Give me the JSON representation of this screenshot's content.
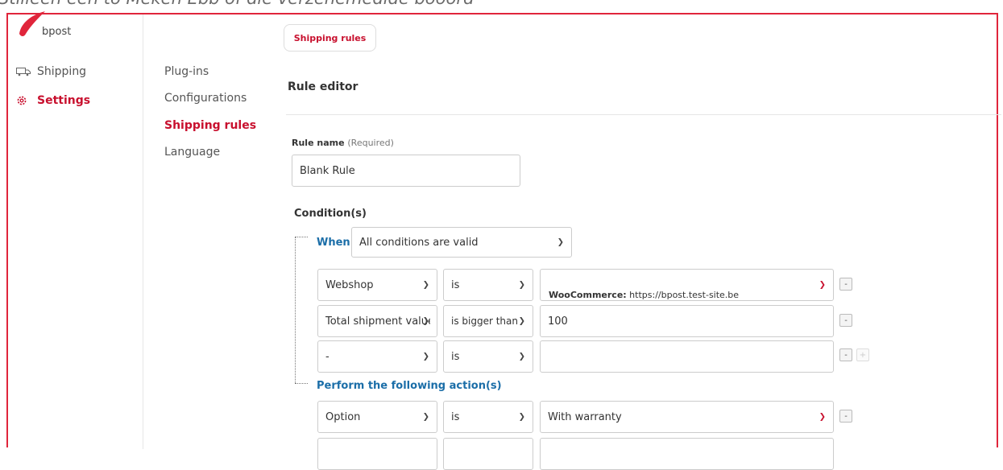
{
  "caption": "Stilleen een to Meken Ebb of die verzenemedide booord",
  "brand": {
    "name": "bpost",
    "accent": "#c8102e",
    "link": "#1b6ea8"
  },
  "sidebar": {
    "items": [
      {
        "label": "Shipping",
        "icon": "truck-icon"
      },
      {
        "label": "Settings",
        "icon": "gear-icon"
      }
    ]
  },
  "subnav": {
    "items": [
      "Plug-ins",
      "Configurations",
      "Shipping rules",
      "Language"
    ]
  },
  "tab": {
    "label": "Shipping rules"
  },
  "editor": {
    "title": "Rule editor",
    "rule_name_label": "Rule name",
    "rule_name_required": "(Required)",
    "rule_name_value": "Blank Rule",
    "conditions_title": "Condition(s)",
    "when_label": "When",
    "when_value": "All conditions are valid",
    "conditions": [
      {
        "field": "Webshop",
        "operator": "is",
        "value_prefix": "WooCommerce:",
        "value": " https://bpost.test-site.be"
      },
      {
        "field": "Total shipment value",
        "operator": "is bigger than",
        "value": "100"
      },
      {
        "field": "-",
        "operator": "is",
        "value": ""
      }
    ],
    "actions_title": "Perform the following action(s)",
    "actions": [
      {
        "field": "Option",
        "operator": "is",
        "value": "With warranty"
      }
    ],
    "remove_label": "-",
    "add_label": "+"
  }
}
